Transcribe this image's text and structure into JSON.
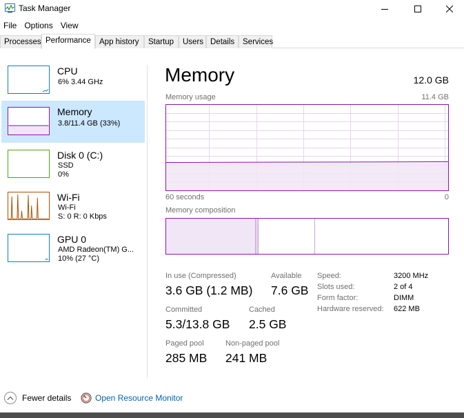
{
  "window": {
    "title": "Task Manager",
    "icon": "task-manager-icon"
  },
  "menu": [
    "File",
    "Options",
    "View"
  ],
  "tabs": [
    "Processes",
    "Performance",
    "App history",
    "Startup",
    "Users",
    "Details",
    "Services"
  ],
  "active_tab": "Performance",
  "sidebar": {
    "items": [
      {
        "name": "CPU",
        "line1": "6%  3.44 GHz",
        "line2": "",
        "color": "#117dbb"
      },
      {
        "name": "Memory",
        "line1": "3.8/11.4 GB (33%)",
        "line2": "",
        "color": "#8b12ae",
        "selected": true
      },
      {
        "name": "Disk 0 (C:)",
        "line1": "SSD",
        "line2": "0%",
        "color": "#4da60c"
      },
      {
        "name": "Wi-Fi",
        "line1": "Wi-Fi",
        "line2": "S: 0 R: 0 Kbps",
        "color": "#a74f01"
      },
      {
        "name": "GPU 0",
        "line1": "AMD Radeon(TM) G...",
        "line2": "10%  (27 °C)",
        "color": "#117dbb"
      }
    ]
  },
  "main": {
    "title": "Memory",
    "total": "12.0 GB",
    "usage_label": "Memory usage",
    "usage_max": "11.4 GB",
    "time_left": "60 seconds",
    "time_right": "0",
    "usage_fraction": 0.33,
    "composition_label": "Memory composition",
    "composition": {
      "in_use_fraction": 0.316,
      "modified_fraction": 0.01,
      "standby_fraction": 0.2
    },
    "stats": {
      "in_use_label": "In use (Compressed)",
      "in_use_value": "3.6 GB (1.2 MB)",
      "available_label": "Available",
      "available_value": "7.6 GB",
      "committed_label": "Committed",
      "committed_value": "5.3/13.8 GB",
      "cached_label": "Cached",
      "cached_value": "2.5 GB",
      "paged_label": "Paged pool",
      "paged_value": "285 MB",
      "nonpaged_label": "Non-paged pool",
      "nonpaged_value": "241 MB"
    },
    "specs": [
      {
        "label": "Speed:",
        "value": "3200 MHz"
      },
      {
        "label": "Slots used:",
        "value": "2 of 4"
      },
      {
        "label": "Form factor:",
        "value": "DIMM"
      },
      {
        "label": "Hardware reserved:",
        "value": "622 MB"
      }
    ]
  },
  "footer": {
    "fewer_details": "Fewer details",
    "open_resmon": "Open Resource Monitor"
  },
  "colors": {
    "accent_memory": "#8b12ae",
    "selected_bg": "#cce8ff",
    "link": "#0063b1"
  }
}
